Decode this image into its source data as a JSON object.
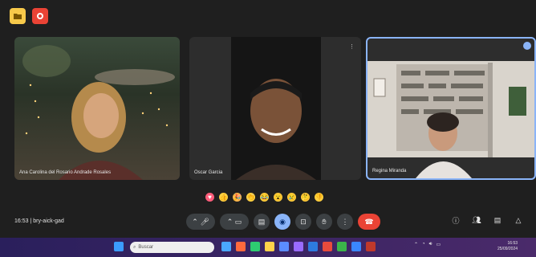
{
  "participants": [
    {
      "name": "Ana Carolina del Rosario Andrade Rosales"
    },
    {
      "name": "Oscar Garcia"
    },
    {
      "name": "Regina Miranda"
    }
  ],
  "meeting": {
    "time": "16:53",
    "code": "bry-aick-gad"
  },
  "taskbar": {
    "search_placeholder": "Buscar"
  },
  "clock": {
    "time": "16:53",
    "date": "25/09/2024"
  },
  "colors": {
    "accent": "#8ab4f8",
    "leave": "#ea4335",
    "badge_yellow": "#f7c94a"
  }
}
